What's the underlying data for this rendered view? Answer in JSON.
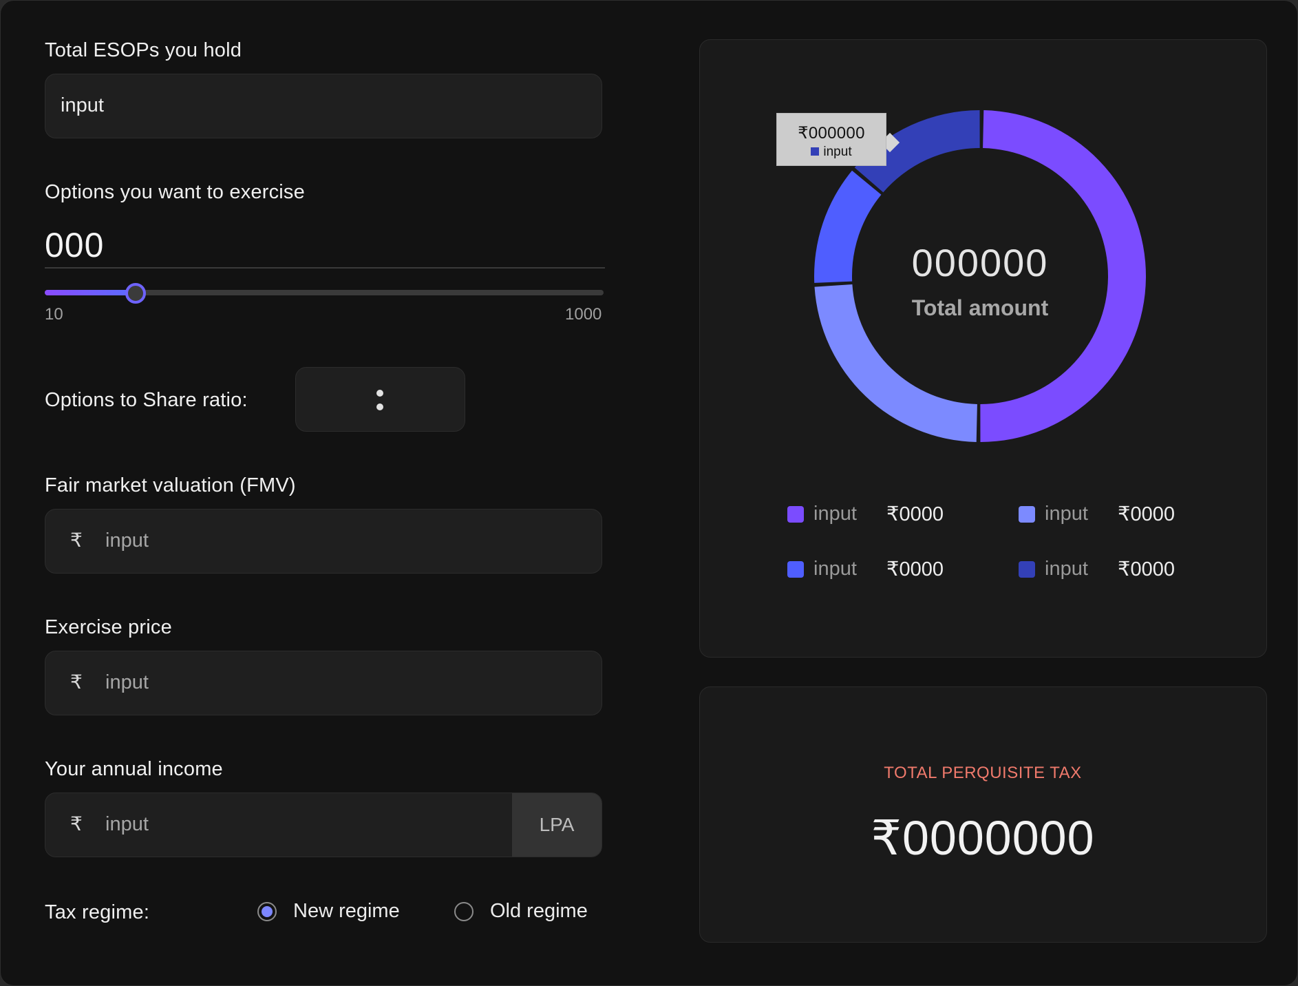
{
  "form": {
    "total_esops": {
      "label": "Total ESOPs you hold",
      "value": "input"
    },
    "options_exercise": {
      "label": "Options you want to exercise",
      "value": "000",
      "slider": {
        "min_label": "10",
        "max_label": "1000",
        "min": 10,
        "max": 1000,
        "fraction": 0.16
      }
    },
    "ratio": {
      "label": "Options to Share ratio:",
      "separator": ":"
    },
    "fmv": {
      "label": "Fair market valuation (FMV)",
      "currency": "₹",
      "placeholder": "input"
    },
    "exercise_price": {
      "label": "Exercise price",
      "currency": "₹",
      "placeholder": "input"
    },
    "annual_income": {
      "label": "Your annual income",
      "currency": "₹",
      "placeholder": "input",
      "suffix": "LPA"
    },
    "tax_regime": {
      "label": "Tax regime:",
      "options": [
        {
          "label": "New regime",
          "selected": true
        },
        {
          "label": "Old regime",
          "selected": false
        }
      ]
    }
  },
  "chart_data": {
    "type": "pie",
    "center_value": "000000",
    "center_label": "Total amount",
    "categories": [
      "input",
      "input",
      "input",
      "input"
    ],
    "values": [
      50,
      24,
      12,
      14
    ],
    "colors": [
      "#7b4cff",
      "#7c8aff",
      "#4f5eff",
      "#3340b7"
    ],
    "legend": [
      {
        "label": "input",
        "value": "₹0000",
        "color": "#7b4cff"
      },
      {
        "label": "input",
        "value": "₹0000",
        "color": "#7c8aff"
      },
      {
        "label": "input",
        "value": "₹0000",
        "color": "#4f5eff"
      },
      {
        "label": "input",
        "value": "₹0000",
        "color": "#3340b7"
      }
    ],
    "tooltip": {
      "value": "₹000000",
      "label": "input",
      "color": "#3340b7"
    }
  },
  "summary": {
    "title": "TOTAL PERQUISITE TAX",
    "value": "₹0000000"
  }
}
